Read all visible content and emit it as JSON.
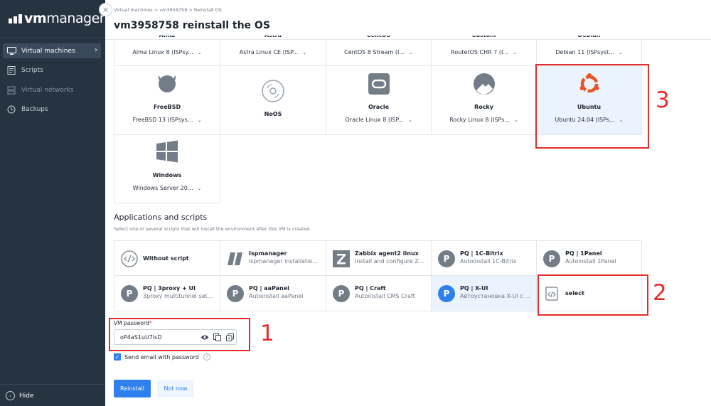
{
  "sidebar": {
    "logo": {
      "bold": "vm",
      "rest": "manager"
    },
    "items": [
      {
        "label": "Virtual machines",
        "icon": "monitor-icon",
        "active": true
      },
      {
        "label": "Scripts",
        "icon": "script-icon"
      },
      {
        "label": "Virtual networks",
        "icon": "network-icon",
        "muted": true
      },
      {
        "label": "Backups",
        "icon": "backup-icon"
      }
    ],
    "hide_label": "Hide"
  },
  "header": {
    "breadcrumb": "Virtual machines  >  vm3958758  >  Reinstall OS",
    "title": "vm3958758 reinstall the OS"
  },
  "os": {
    "top_row": [
      {
        "name": "Alma",
        "version": "Alma Linux 8 (ISPsy..."
      },
      {
        "name": "Astra",
        "version": "Astra Linux CE (ISP..."
      },
      {
        "name": "CentOS",
        "version": "CentOS 8 Stream (I..."
      },
      {
        "name": "Custom",
        "version": "RouterOS CHR 7 (I..."
      },
      {
        "name": "Debian",
        "version": "Debian 11 (ISPsyst..."
      }
    ],
    "row2": [
      {
        "name": "FreeBSD",
        "version": "FreeBSD 13 (ISPsys...",
        "icon": "freebsd-icon"
      },
      {
        "name": "NoOS",
        "version": "",
        "icon": "disc-icon"
      },
      {
        "name": "Oracle",
        "version": "Oracle Linux 8 (ISP...",
        "icon": "oracle-icon"
      },
      {
        "name": "Rocky",
        "version": "Rocky Linux 8 (ISPs...",
        "icon": "rocky-icon"
      },
      {
        "name": "Ubuntu",
        "version": "Ubuntu 24.04 (ISPs...",
        "icon": "ubuntu-icon",
        "selected": true
      }
    ],
    "row3": [
      {
        "name": "Windows",
        "version": "Windows Server 20...",
        "icon": "windows-icon"
      }
    ]
  },
  "scripts": {
    "title": "Applications and scripts",
    "subtitle": "Select one or several scripts that will install the environment after this VM is created.",
    "row1": [
      {
        "name": "Without script",
        "desc": "",
        "icon": "no-script-icon"
      },
      {
        "name": "Ispmanager",
        "desc": "Ispmanager installatio...",
        "icon": "ispmanager-icon"
      },
      {
        "name": "Zabbix agent2 linux",
        "desc": "Install and configure Z...",
        "icon": "zabbix-icon"
      },
      {
        "name": "PQ | 1C-Bitrix",
        "desc": "Autoinstall 1C-Bitrix",
        "icon": "p-icon"
      },
      {
        "name": "PQ | 1Panel",
        "desc": "Autoinstall 1Panel",
        "icon": "p-icon"
      }
    ],
    "row2": [
      {
        "name": "PQ | 3proxy + UI",
        "desc": "3proxy multitunnel set...",
        "icon": "p-icon"
      },
      {
        "name": "PQ | aaPanel",
        "desc": "Autoinstall aaPanel",
        "icon": "p-icon"
      },
      {
        "name": "PQ | Craft",
        "desc": "Autoinstall CMS Craft",
        "icon": "p-icon"
      },
      {
        "name": "PQ | X-UI",
        "desc": "Автоустановка X-UI с ...",
        "icon": "p-icon",
        "selected": true
      },
      {
        "name": "select",
        "desc": "",
        "icon": "code-script-icon"
      }
    ]
  },
  "password": {
    "label": "VM password",
    "required": "*",
    "value": "oP4aS1uU7lsD"
  },
  "email_checkbox": {
    "label": "Send email with password",
    "checked": true
  },
  "buttons": {
    "primary": "Reinstall",
    "secondary": "Not now"
  },
  "annotations": [
    "1",
    "2",
    "3"
  ],
  "colors": {
    "accent": "#2f80ed",
    "sidebar": "#263441",
    "annotation": "#e52b2b",
    "selected_bg": "#eaf3fe"
  }
}
